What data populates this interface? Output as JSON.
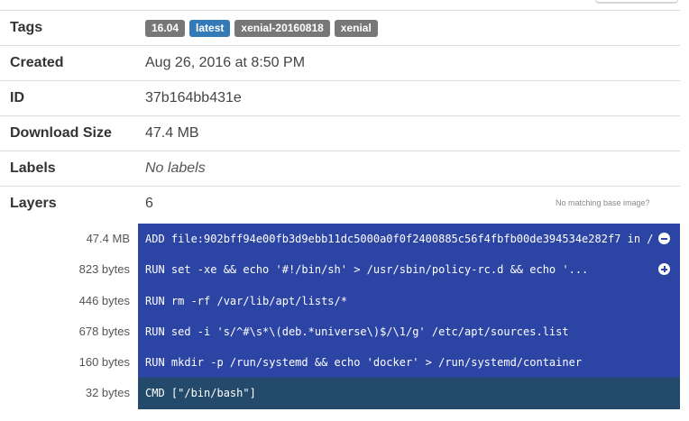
{
  "tags": {
    "label": "Tags",
    "items": [
      {
        "text": "16.04",
        "style": "default"
      },
      {
        "text": "latest",
        "style": "latest"
      },
      {
        "text": "xenial-20160818",
        "style": "default"
      },
      {
        "text": "xenial",
        "style": "default"
      }
    ]
  },
  "created": {
    "label": "Created",
    "value": "Aug 26, 2016 at 8:50 PM"
  },
  "id": {
    "label": "ID",
    "value": "37b164bb431e"
  },
  "download_size": {
    "label": "Download Size",
    "value": "47.4 MB"
  },
  "labels": {
    "label": "Labels",
    "value": "No labels"
  },
  "layers": {
    "label": "Layers",
    "value": "6",
    "base_image_note": "No matching base image?",
    "items": [
      {
        "size": "47.4 MB",
        "command": "ADD file:902bff94e00fb3d9ebb11dc5000a0f0f2400885c56f4fbfb00de394534e282f7 in /",
        "toggle": "collapse-icon"
      },
      {
        "size": "823 bytes",
        "command": "RUN set -xe && echo '#!/bin/sh' > /usr/sbin/policy-rc.d && echo '...",
        "toggle": "expand-icon"
      },
      {
        "size": "446 bytes",
        "command": "RUN rm -rf /var/lib/apt/lists/*"
      },
      {
        "size": "678 bytes",
        "command": "RUN sed -i 's/^#\\s*\\(deb.*universe\\)$/\\1/g' /etc/apt/sources.list"
      },
      {
        "size": "160 bytes",
        "command": "RUN mkdir -p /run/systemd && echo 'docker' > /run/systemd/container"
      },
      {
        "size": "32 bytes",
        "command": "CMD [\"/bin/bash\"]"
      }
    ]
  },
  "colors": {
    "layer_background": "#2c44a4",
    "last_layer_background": "#234a6a",
    "tag_default": "#777777",
    "tag_latest": "#337ab7"
  }
}
